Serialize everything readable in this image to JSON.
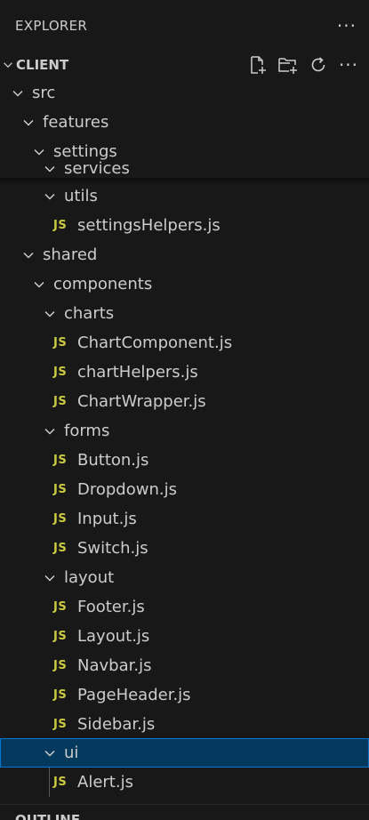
{
  "pane": {
    "title": "EXPLORER"
  },
  "section": {
    "title": "CLIENT"
  },
  "folders": {
    "src": "src",
    "features": "features",
    "settings": "settings",
    "services": "services",
    "utils": "utils",
    "shared": "shared",
    "components": "components",
    "charts": "charts",
    "forms": "forms",
    "layout": "layout",
    "ui": "ui"
  },
  "files": {
    "settingsHelpers": "settingsHelpers.js",
    "ChartComponent": "ChartComponent.js",
    "chartHelpers": "chartHelpers.js",
    "ChartWrapper": "ChartWrapper.js",
    "Button": "Button.js",
    "Dropdown": "Dropdown.js",
    "Input": "Input.js",
    "Switch": "Switch.js",
    "Footer": "Footer.js",
    "Layout": "Layout.js",
    "Navbar": "Navbar.js",
    "PageHeader": "PageHeader.js",
    "Sidebar": "Sidebar.js",
    "Alert": "Alert.js"
  },
  "file_icon_text": "JS",
  "outline": {
    "title": "OUTLINE"
  },
  "colors": {
    "background": "#181818",
    "selection": "#04395e",
    "focus_border": "#0078d4",
    "js_icon": "#cbcb41",
    "text": "#cccccc"
  }
}
